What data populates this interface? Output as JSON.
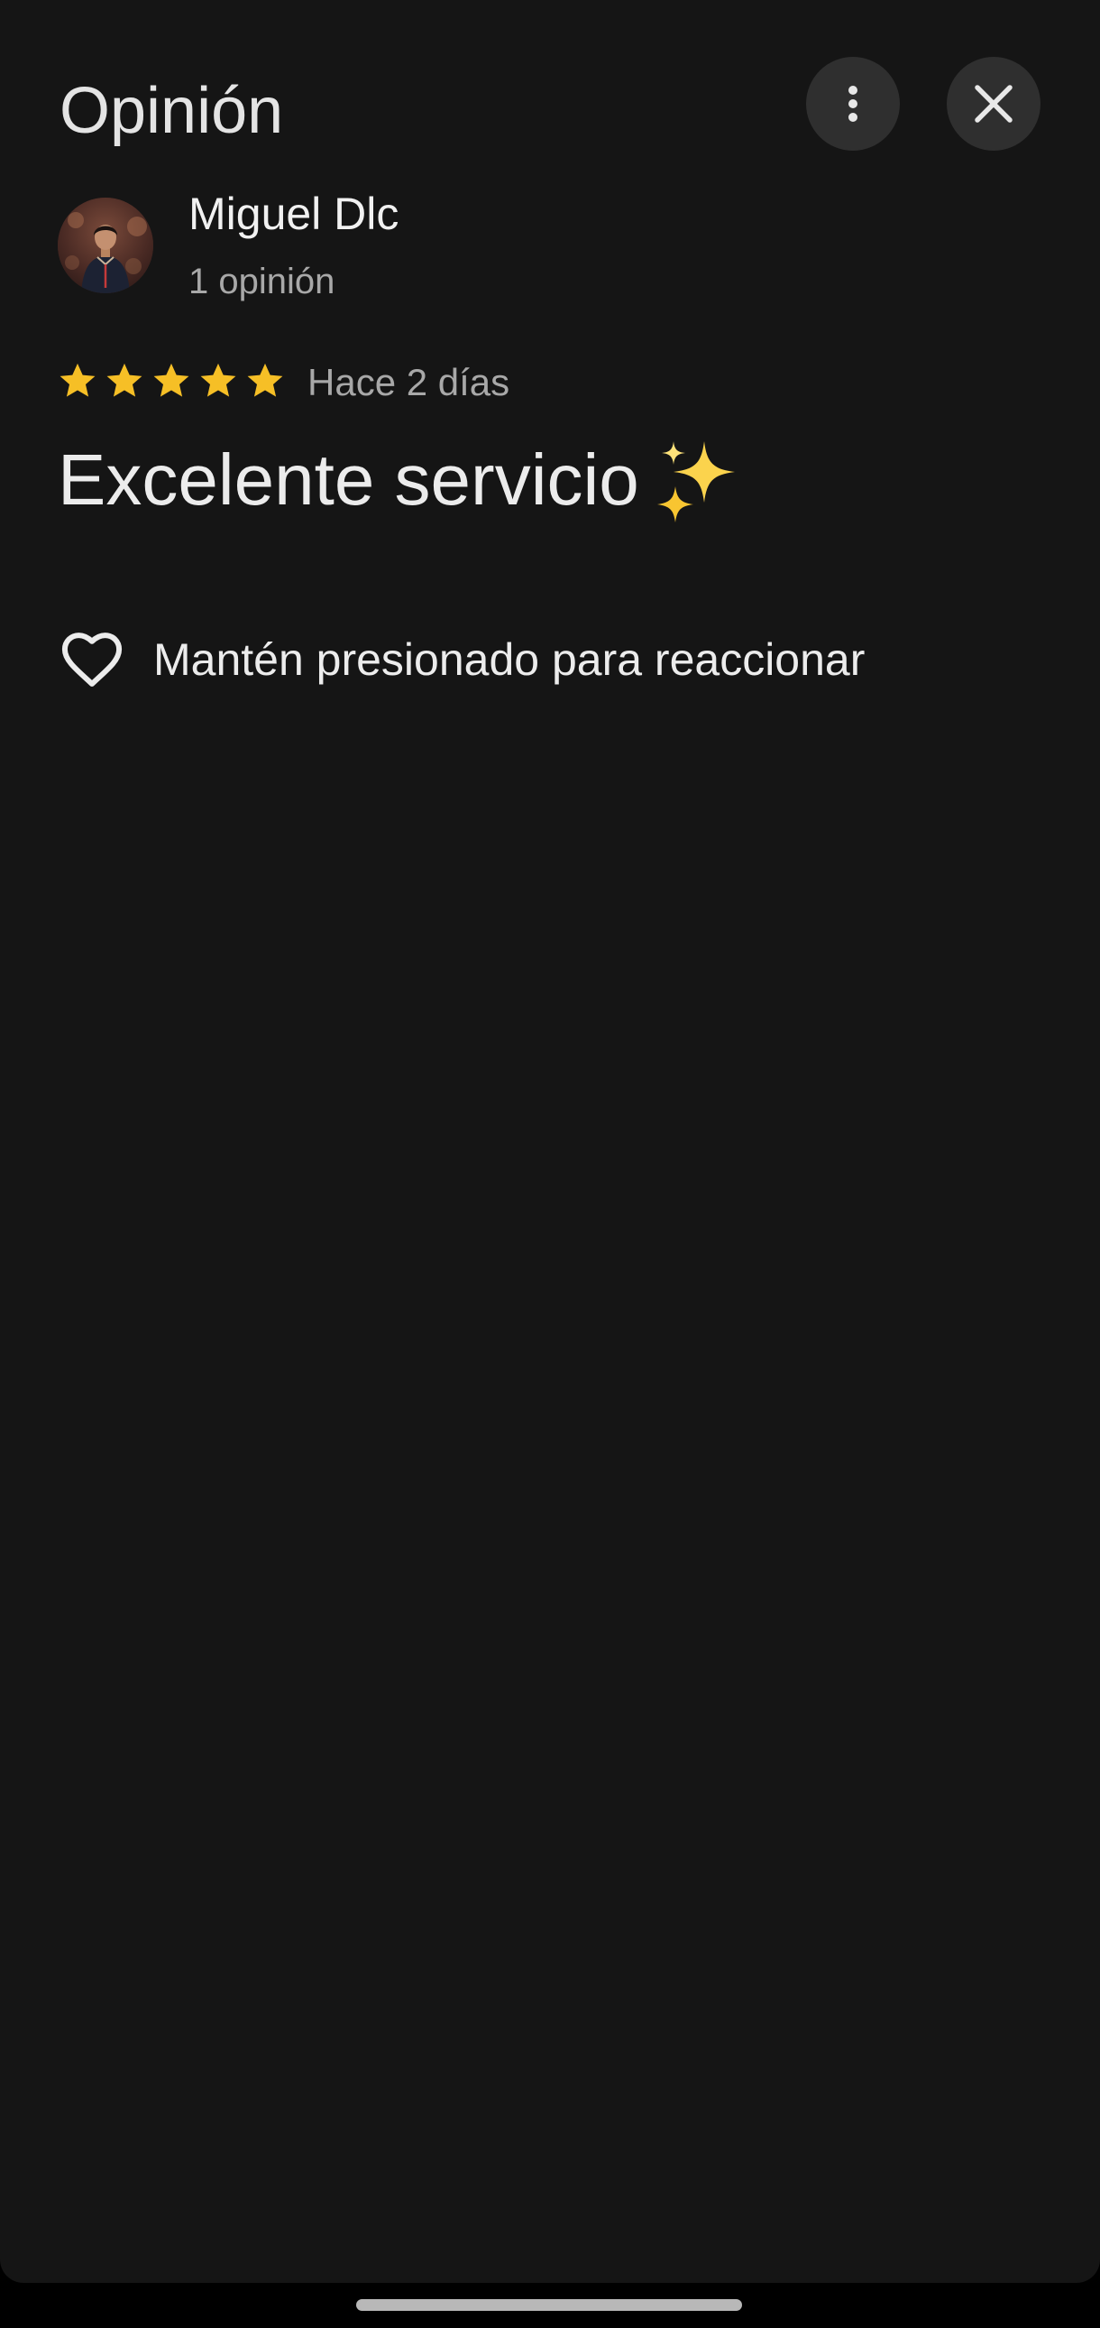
{
  "header": {
    "title": "Opinión",
    "more_icon": "more-vert-icon",
    "close_icon": "close-icon"
  },
  "author": {
    "name": "Miguel Dlc",
    "review_count": "1 opinión"
  },
  "review": {
    "rating": 5,
    "max_rating": 5,
    "date": "Hace 2 días",
    "text": "Excelente servicio",
    "emoji": "sparkles-emoji"
  },
  "reaction": {
    "icon": "heart-outline-icon",
    "label": "Mantén presionado para reaccionar"
  },
  "colors": {
    "background": "#151515",
    "star": "#f6bf26",
    "primary_text": "#ececec",
    "secondary_text": "#a8a8a8",
    "button_bg": "#2f2f2f"
  }
}
